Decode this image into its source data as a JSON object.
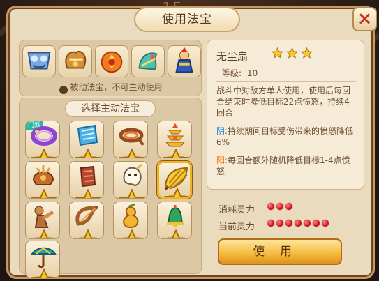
{
  "header": {
    "title": "使用法宝",
    "close_icon": "close-icon"
  },
  "passive": {
    "note": "被动法宝，不可主动使用",
    "items": [
      "passive-treasure-1",
      "passive-treasure-2",
      "passive-treasure-3",
      "passive-treasure-4",
      "passive-treasure-5"
    ]
  },
  "active": {
    "title": "选择主动法宝",
    "items": [
      {
        "name": "purple-ring",
        "badge": "门派",
        "stars": 3
      },
      {
        "name": "blue-scroll",
        "badge": "",
        "stars": 3
      },
      {
        "name": "brown-rope",
        "badge": "",
        "stars": 3
      },
      {
        "name": "golden-pagoda",
        "badge": "",
        "stars": 3
      },
      {
        "name": "bronze-helmet",
        "badge": "",
        "stars": 3
      },
      {
        "name": "red-bracer",
        "badge": "",
        "stars": 3
      },
      {
        "name": "ghost-spirit",
        "badge": "",
        "stars": 3
      },
      {
        "name": "golden-fan",
        "badge": "",
        "stars": 3,
        "selected": true
      },
      {
        "name": "wood-figure",
        "badge": "",
        "stars": 3
      },
      {
        "name": "bow-weapon",
        "badge": "",
        "stars": 3
      },
      {
        "name": "golden-gourd",
        "badge": "",
        "stars": 3
      },
      {
        "name": "green-bell",
        "badge": "",
        "stars": 3
      },
      {
        "name": "green-umbrella",
        "badge": "",
        "stars": 1
      }
    ]
  },
  "detail": {
    "name": "无尘扇",
    "stars": 3,
    "level_label": "等级:",
    "level_value": "10",
    "description": "战斗中对敌方单人使用，使用后每回合结束时降低目标22点愤怒，持续4回合",
    "yin_tag": "阴:",
    "yin_text": "持续期间目标受伤带来的愤怒降低6%",
    "yang_tag": "阳:",
    "yang_text": "每回合额外随机降低目标1-4点愤怒"
  },
  "costs": {
    "consume_label": "消耗灵力",
    "consume_value": 3,
    "current_label": "当前灵力",
    "current_value": 7
  },
  "action": {
    "use_label": "使用"
  },
  "colors": {
    "accent": "#f4be43",
    "yin": "#2a8be0",
    "yang": "#f07c17",
    "power": "#d20f1d",
    "selected": "#f2b323"
  },
  "edge": {
    "number": "15"
  }
}
